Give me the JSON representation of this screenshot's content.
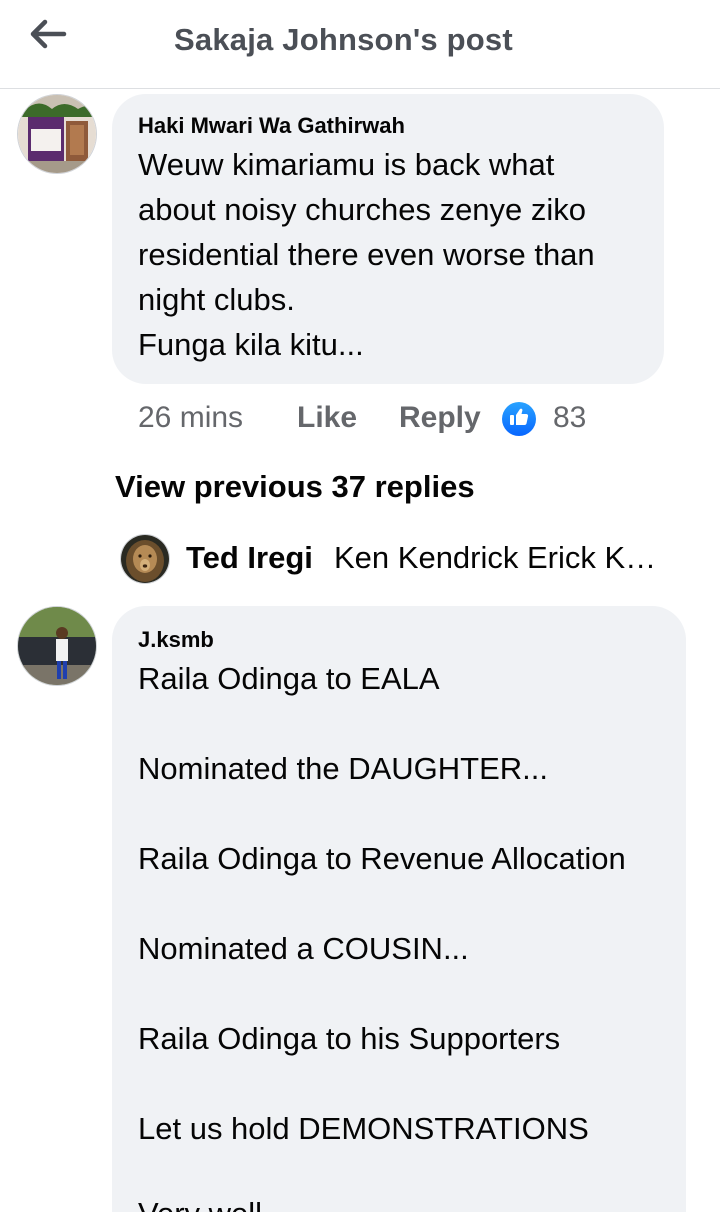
{
  "header": {
    "title": "Sakaja Johnson's post",
    "back_icon": "arrow-left-icon"
  },
  "comment1": {
    "author": "Haki Mwari Wa Gathirwah",
    "lines": [
      "Weuw kimariamu is back what",
      "about noisy churches zenye ziko",
      "residential there even worse than",
      "night clubs.",
      "Funga kila kitu..."
    ],
    "time": "26 mins",
    "like_label": "Like",
    "reply_label": "Reply",
    "reaction_icon": "thumbs-up-icon",
    "reaction_count": "83",
    "accent_color": "#1877f2"
  },
  "view_previous": "View previous 37 replies",
  "reply_preview": {
    "name": "Ted Iregi",
    "text": "Ken Kendrick Erick K…"
  },
  "comment2": {
    "author": "J.ksmb",
    "lines": [
      "Raila Odinga to EALA",
      "Nominated the DAUGHTER...",
      "Raila Odinga to Revenue Allocation",
      "Nominated a COUSIN...",
      "Raila Odinga to his Supporters",
      "Let us hold DEMONSTRATIONS",
      "Very well..."
    ]
  }
}
